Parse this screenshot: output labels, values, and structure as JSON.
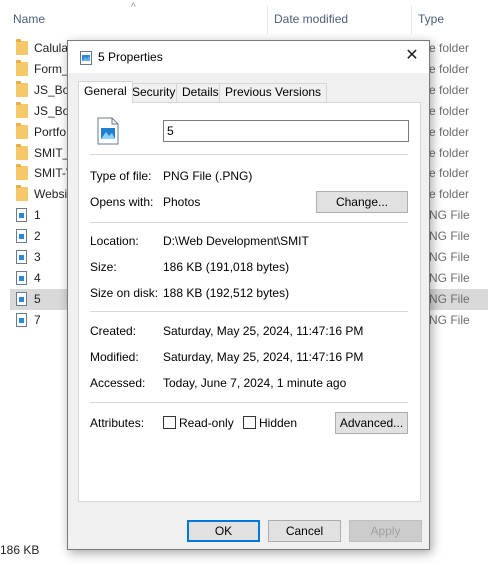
{
  "explorer": {
    "columns": {
      "name": "Name",
      "date_modified": "Date modified",
      "type": "Type"
    },
    "rows": [
      {
        "name": "Calula",
        "type": "e folder",
        "icon": "folder-icon"
      },
      {
        "name": "Form_",
        "type": "e folder",
        "icon": "folder-icon"
      },
      {
        "name": "JS_Boo",
        "type": "e folder",
        "icon": "folder-icon"
      },
      {
        "name": "JS_Boo",
        "type": "e folder",
        "icon": "folder-icon"
      },
      {
        "name": "Portfo",
        "type": "e folder",
        "icon": "folder-icon"
      },
      {
        "name": "SMIT_V",
        "type": "e folder",
        "icon": "folder-icon"
      },
      {
        "name": "SMIT-V",
        "type": "e folder",
        "icon": "folder-icon"
      },
      {
        "name": "Websit",
        "type": "e folder",
        "icon": "folder-icon"
      },
      {
        "name": "1",
        "type": "NG File",
        "icon": "png-file-icon"
      },
      {
        "name": "2",
        "type": "NG File",
        "icon": "png-file-icon"
      },
      {
        "name": "3",
        "type": "NG File",
        "icon": "png-file-icon"
      },
      {
        "name": "4",
        "type": "NG File",
        "icon": "png-file-icon"
      },
      {
        "name": "5",
        "type": "NG File",
        "icon": "png-file-icon",
        "selected": true
      },
      {
        "name": "7",
        "type": "NG File",
        "icon": "png-file-icon"
      }
    ],
    "status": "186 KB"
  },
  "dialog": {
    "title": "5 Properties",
    "close_glyph": "✕",
    "tabs": [
      "General",
      "Security",
      "Details",
      "Previous Versions"
    ],
    "active_tab": "General",
    "file_name": "5",
    "type_of_file_label": "Type of file:",
    "type_of_file": "PNG File (.PNG)",
    "opens_with_label": "Opens with:",
    "opens_with": "Photos",
    "change_button": "Change...",
    "location_label": "Location:",
    "location": "D:\\Web Development\\SMIT",
    "size_label": "Size:",
    "size": "186 KB (191,018 bytes)",
    "size_on_disk_label": "Size on disk:",
    "size_on_disk": "188 KB (192,512 bytes)",
    "created_label": "Created:",
    "created": "Saturday, May 25, 2024, 11:47:16 PM",
    "modified_label": "Modified:",
    "modified": "Saturday, May 25, 2024, 11:47:16 PM",
    "accessed_label": "Accessed:",
    "accessed": "Today, June 7, 2024, 1 minute ago",
    "attributes_label": "Attributes:",
    "readonly_label": "Read-only",
    "hidden_label": "Hidden",
    "advanced_button": "Advanced...",
    "ok_button": "OK",
    "cancel_button": "Cancel",
    "apply_button": "Apply"
  },
  "colors": {
    "accent": "#0078d7",
    "selected_row": "#d9d9d9",
    "dialog_bg": "#f0f0f0"
  }
}
